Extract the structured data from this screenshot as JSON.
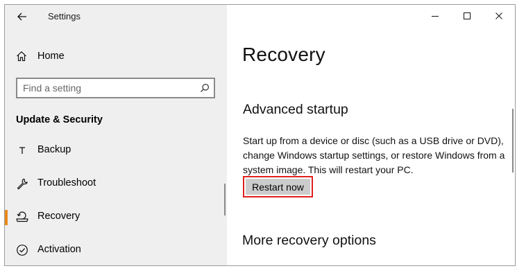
{
  "app": {
    "title": "Settings"
  },
  "sidebar": {
    "home_label": "Home",
    "search_placeholder": "Find a setting",
    "section_title": "Update & Security",
    "items": [
      {
        "label": "Backup",
        "icon": "backup-icon"
      },
      {
        "label": "Troubleshoot",
        "icon": "wrench-icon"
      },
      {
        "label": "Recovery",
        "icon": "recovery-icon",
        "selected": true
      },
      {
        "label": "Activation",
        "icon": "check-circle-icon"
      }
    ]
  },
  "main": {
    "page_title": "Recovery",
    "advanced_startup": {
      "heading": "Advanced startup",
      "description": "Start up from a device or disc (such as a USB drive or DVD), change Windows startup settings, or restore Windows from a system image. This will restart your PC.",
      "button_label": "Restart now"
    },
    "more_options_heading": "More recovery options"
  },
  "colors": {
    "accent": "#e88a1a",
    "highlight_border": "#e0201c",
    "button_bg": "#cccccc",
    "sidebar_bg": "#efefef"
  }
}
